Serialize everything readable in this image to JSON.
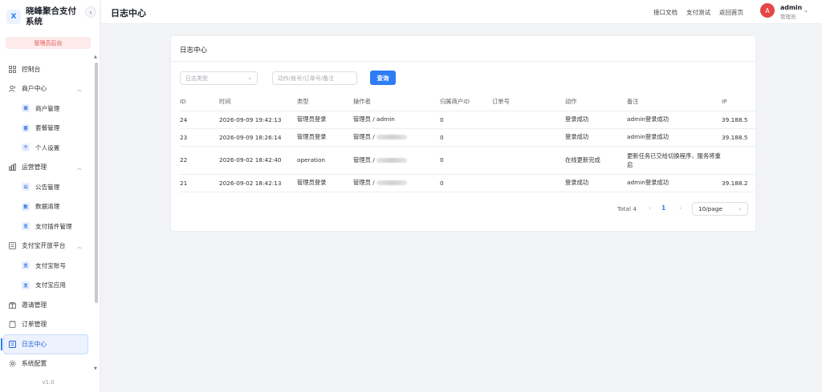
{
  "brand": {
    "logo": "X",
    "title": "晓峰聚合支付系统",
    "collapse_icon": "‹"
  },
  "admin_badge": "管理员后台",
  "sidebar": {
    "items": [
      {
        "label": "控制台",
        "icon": "dashboard-icon"
      },
      {
        "label": "商户中心",
        "icon": "merchant-icon",
        "expanded": true,
        "children": [
          {
            "label": "商户管理",
            "badge": "商"
          },
          {
            "label": "套餐管理",
            "badge": "套"
          },
          {
            "label": "个人设置",
            "badge": "个"
          }
        ]
      },
      {
        "label": "运营管理",
        "icon": "chart-icon",
        "expanded": true,
        "children": [
          {
            "label": "公告管理",
            "badge": "公"
          },
          {
            "label": "数据清理",
            "badge": "数"
          },
          {
            "label": "支付插件管理",
            "badge": "支"
          }
        ]
      },
      {
        "label": "支付宝开放平台",
        "icon": "platform-icon",
        "expanded": true,
        "children": [
          {
            "label": "支付宝账号",
            "badge": "支"
          },
          {
            "label": "支付宝应用",
            "badge": "支"
          }
        ]
      },
      {
        "label": "邀请管理",
        "icon": "invite-icon"
      },
      {
        "label": "订单管理",
        "icon": "order-icon"
      },
      {
        "label": "日志中心",
        "icon": "log-icon",
        "active": true
      },
      {
        "label": "系统配置",
        "icon": "gear-icon"
      }
    ]
  },
  "version": "v1.0",
  "header": {
    "title": "日志中心",
    "links": [
      "接口文档",
      "支付测试",
      "返回首页"
    ],
    "user": {
      "avatar": "A",
      "name": "admin",
      "role": "管理员"
    }
  },
  "card": {
    "title": "日志中心",
    "filters": {
      "type_placeholder": "日志类型",
      "search_placeholder": "动作/账号/订单号/备注",
      "query_label": "查询"
    },
    "table": {
      "columns": [
        "ID",
        "时间",
        "类型",
        "操作者",
        "归属商户ID",
        "订单号",
        "动作",
        "备注",
        "IP"
      ],
      "rows": [
        {
          "id": "24",
          "time": "2026-09-09 19:42:13",
          "type": "管理员登录",
          "operator": "管理员 / admin",
          "merchant_id": "0",
          "order_no": "",
          "action": "登录成功",
          "note": "admin登录成功",
          "ip": "39.188.5"
        },
        {
          "id": "23",
          "time": "2026-09-09 18:26:14",
          "type": "管理员登录",
          "operator": "管理员 / ",
          "merchant_id": "0",
          "order_no": "",
          "action": "登录成功",
          "note": "admin登录成功",
          "ip": "39.188.5"
        },
        {
          "id": "22",
          "time": "2026-09-02 18:42:40",
          "type": "operation",
          "operator": "管理员 / ",
          "merchant_id": "0",
          "order_no": "",
          "action": "在线更新完成",
          "note": "更新任务已交给切换程序，服务将重启",
          "ip": ""
        },
        {
          "id": "21",
          "time": "2026-09-02 18:42:13",
          "type": "管理员登录",
          "operator": "管理员 / ",
          "merchant_id": "0",
          "order_no": "",
          "action": "登录成功",
          "note": "admin登录成功",
          "ip": "39.188.2"
        }
      ]
    },
    "pagination": {
      "total": "Total 4",
      "current": "1",
      "page_size": "10/page"
    }
  },
  "colors": {
    "primary": "#2f7cf6",
    "avatar": "#e54646",
    "badge_bg": "#fdeaea",
    "badge_text": "#e35353"
  }
}
